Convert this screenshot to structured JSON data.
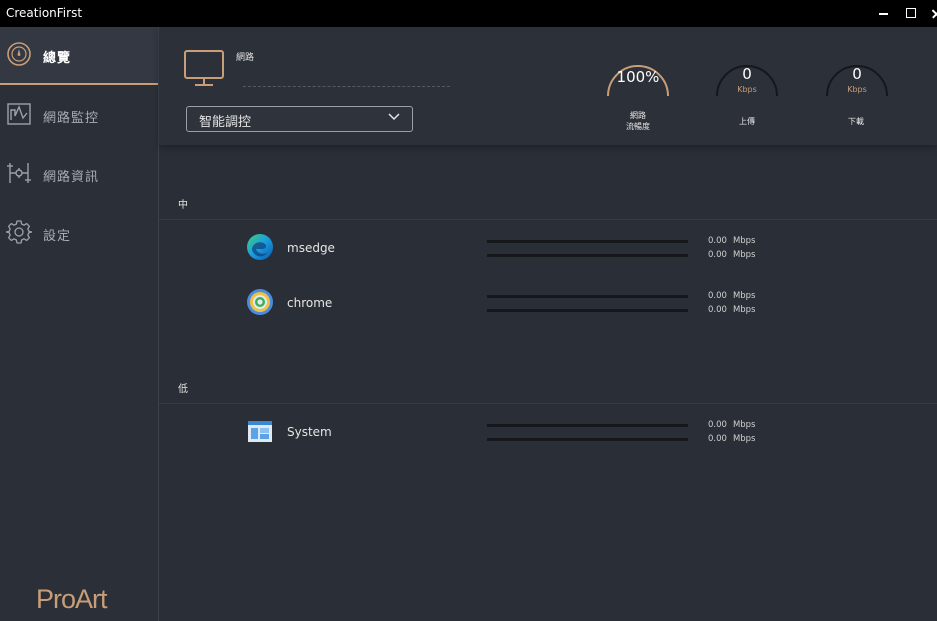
{
  "window": {
    "title": "CreationFirst"
  },
  "sidebar": {
    "items": [
      {
        "label": "總覽",
        "icon": "speedometer-icon",
        "active": true
      },
      {
        "label": "網路監控",
        "icon": "chart-monitor-icon",
        "active": false
      },
      {
        "label": "網路資訊",
        "icon": "network-topology-icon",
        "active": false
      },
      {
        "label": "設定",
        "icon": "gear-icon",
        "active": false
      }
    ],
    "logo": "ProArt"
  },
  "header": {
    "network_label": "網路",
    "mode_dropdown": {
      "selected": "智能調控"
    },
    "gauges": [
      {
        "value": "100%",
        "unit": "",
        "caption_line1": "網路",
        "caption_line2": "流暢度"
      },
      {
        "value": "0",
        "unit": "Kbps",
        "caption_line1": "上傳",
        "caption_line2": ""
      },
      {
        "value": "0",
        "unit": "Kbps",
        "caption_line1": "下載",
        "caption_line2": ""
      }
    ]
  },
  "groups": [
    {
      "label": "中",
      "apps": [
        {
          "name": "msedge",
          "icon": "edge-browser-icon",
          "upload": "0.00",
          "download": "0.00",
          "unit": "Mbps"
        },
        {
          "name": "chrome",
          "icon": "chrome-browser-icon",
          "upload": "0.00",
          "download": "0.00",
          "unit": "Mbps"
        }
      ]
    },
    {
      "label": "低",
      "apps": [
        {
          "name": "System",
          "icon": "system-window-icon",
          "upload": "0.00",
          "download": "0.00",
          "unit": "Mbps"
        }
      ]
    }
  ],
  "colors": {
    "accent": "#c79e78",
    "background": "#2a2e36",
    "titlebar": "#000000"
  }
}
